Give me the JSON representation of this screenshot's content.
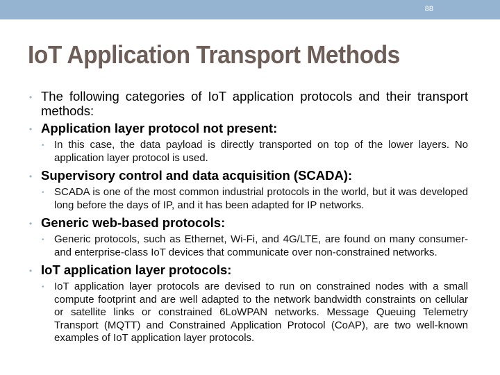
{
  "header": {
    "slide_number": "88"
  },
  "title": "IoT Application Transport Methods",
  "bullets": [
    {
      "text": "The following categories of IoT application protocols and their transport methods:",
      "bold": false,
      "children": []
    },
    {
      "text": "Application layer protocol not present:",
      "bold": true,
      "children": [
        "In this case, the data payload is directly transported on top of the lower layers. No application layer protocol is used."
      ]
    },
    {
      "text": "Supervisory control and data acquisition (SCADA):",
      "bold": true,
      "children": [
        "SCADA is one of the most common industrial protocols in the world, but it was developed long before the days of IP, and it has been adapted for IP networks."
      ]
    },
    {
      "text": "Generic web-based protocols:",
      "bold": true,
      "children": [
        "Generic protocols, such as Ethernet, Wi-Fi, and 4G/LTE, are found on many consumer- and enterprise-class IoT devices that communicate over non-constrained networks."
      ]
    },
    {
      "text": "IoT application layer protocols:",
      "bold": true,
      "children": [
        "IoT application layer protocols are devised to run on constrained nodes with a small compute footprint and are well adapted to the network bandwidth constraints on cellular or satellite links or constrained 6LoWPAN networks. Message Queuing Telemetry Transport (MQTT) and Constrained Application Protocol (CoAP), are two well-known examples of IoT application layer protocols."
      ]
    }
  ],
  "bullet_glyph": "•",
  "colors": {
    "topbar": "#94b4d2",
    "title": "#6e5e58",
    "bullet": "#9fb2c4"
  }
}
